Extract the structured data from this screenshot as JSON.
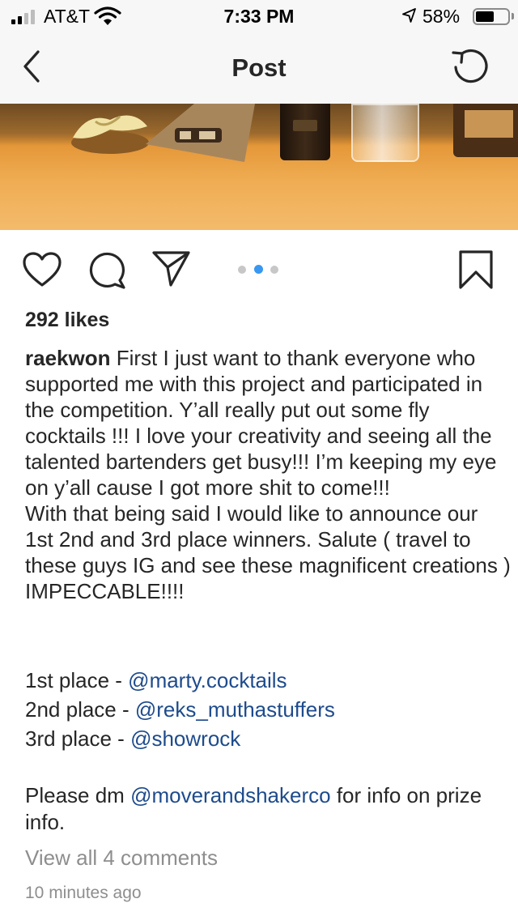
{
  "status_bar": {
    "carrier": "AT&T",
    "time": "7:33 PM",
    "battery_percent": "58%",
    "battery_level": 0.58,
    "signal_bars": 2,
    "icons": [
      "signal-icon",
      "wifi-icon",
      "location-arrow-icon",
      "battery-icon"
    ]
  },
  "nav": {
    "title": "Post",
    "icons": [
      "back-chevron-icon",
      "refresh-icon"
    ]
  },
  "post": {
    "icons": [
      "heart-icon",
      "comment-icon",
      "share-icon",
      "bookmark-icon"
    ],
    "carousel_pages": 3,
    "carousel_active_index": 1,
    "accent_color": "#3897f0",
    "mention_color": "#1e4b8c",
    "likes": "292 likes",
    "username": "raekwon",
    "caption": "First I just want to thank everyone who supported me with this project and participated in the competition. Y’all really put out some fly cocktails !!! I love your creativity and seeing all the talented bartenders get busy!!! I’m keeping my eye on y’all cause I got more shit to come!!!",
    "caption_2": "With that being said I would like to announce our 1st 2nd and 3rd place winners.  Salute ( travel to these guys IG and see these magnificent creations ) IMPECCABLE!!!!",
    "placings": [
      {
        "label": "1st place - ",
        "handle": "@marty.cocktails"
      },
      {
        "label": "2nd place - ",
        "handle": "@reks_muthastuffers"
      },
      {
        "label": "3rd place - ",
        "handle": "@showrock"
      }
    ],
    "dm": {
      "prefix": "Please dm ",
      "handle": "@moverandshakerco",
      "suffix": " for info on prize info."
    },
    "view_comments": "View all 4 comments",
    "timestamp": "10 minutes ago"
  }
}
